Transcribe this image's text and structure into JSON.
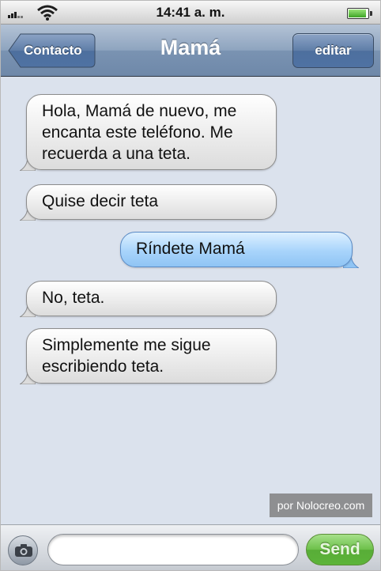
{
  "status_bar": {
    "time": "14:41 a. m."
  },
  "nav": {
    "title": "Mamá",
    "back_label": "Contacto",
    "edit_label": "editar"
  },
  "messages": [
    {
      "direction": "incoming",
      "text": "Hola, Mamá de nuevo, me\nencanta este teléfono. Me\nrecuerda a una teta."
    },
    {
      "direction": "incoming",
      "text": "Quise decir teta"
    },
    {
      "direction": "outgoing",
      "text": "Ríndete Mamá"
    },
    {
      "direction": "incoming",
      "text": "No, teta."
    },
    {
      "direction": "incoming",
      "text": "Simplemente me sigue\nescribiendo teta."
    }
  ],
  "watermark": "por Nolocreo.com",
  "compose": {
    "value": "",
    "send_label": "Send"
  },
  "icons": {
    "signal": "signal-icon",
    "wifi": "wifi-icon",
    "battery": "battery-icon",
    "camera": "camera-icon"
  },
  "colors": {
    "incoming_bubble": "#e6e6e6",
    "outgoing_bubble": "#a8d4fb",
    "send_button": "#6cc04a",
    "nav_bar": "#8ea4bf"
  }
}
